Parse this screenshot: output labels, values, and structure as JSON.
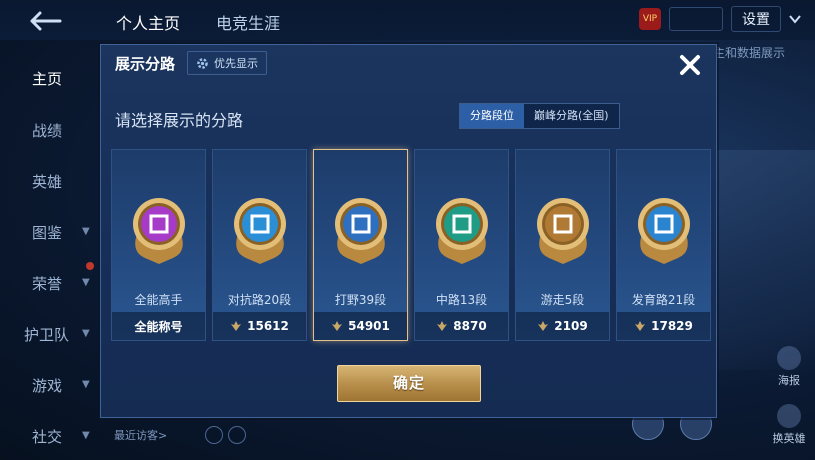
{
  "top_nav": {
    "tabs": [
      {
        "label": "个人主页"
      },
      {
        "label": "电竞生涯"
      }
    ],
    "settings_label": "设置",
    "right_hint": "主和数据展示"
  },
  "sidebar": {
    "items": [
      {
        "label": "主页"
      },
      {
        "label": "战绩"
      },
      {
        "label": "英雄"
      },
      {
        "label": "图鉴"
      },
      {
        "label": "荣誉"
      },
      {
        "label": "护卫队"
      },
      {
        "label": "游戏"
      },
      {
        "label": "社交"
      }
    ]
  },
  "right_buttons": [
    {
      "label": "海报"
    },
    {
      "label": "换英雄"
    }
  ],
  "visitors_label": "最近访客>",
  "modal": {
    "title": "展示分路",
    "priority_label": "优先显示",
    "subtitle": "请选择展示的分路",
    "toggle": [
      {
        "label": "分路段位",
        "active": true
      },
      {
        "label": "巅峰分路(全国)",
        "active": false
      }
    ],
    "cards": [
      {
        "label": "全能高手",
        "score": "全能称号",
        "color": "#a63bc7",
        "icon": "all-round-icon",
        "selected": false
      },
      {
        "label": "对抗路20段",
        "score": "15612",
        "color": "#2a8fd6",
        "icon": "clash-lane-icon",
        "selected": false
      },
      {
        "label": "打野39段",
        "score": "54901",
        "color": "#2f6fc0",
        "icon": "jungle-icon",
        "selected": true
      },
      {
        "label": "中路13段",
        "score": "8870",
        "color": "#1f9c86",
        "icon": "mid-lane-icon",
        "selected": false
      },
      {
        "label": "游走5段",
        "score": "2109",
        "color": "#b07a34",
        "icon": "roam-icon",
        "selected": false
      },
      {
        "label": "发育路21段",
        "score": "17829",
        "color": "#2a84d0",
        "icon": "farm-lane-icon",
        "selected": false
      }
    ],
    "confirm_label": "确定"
  }
}
